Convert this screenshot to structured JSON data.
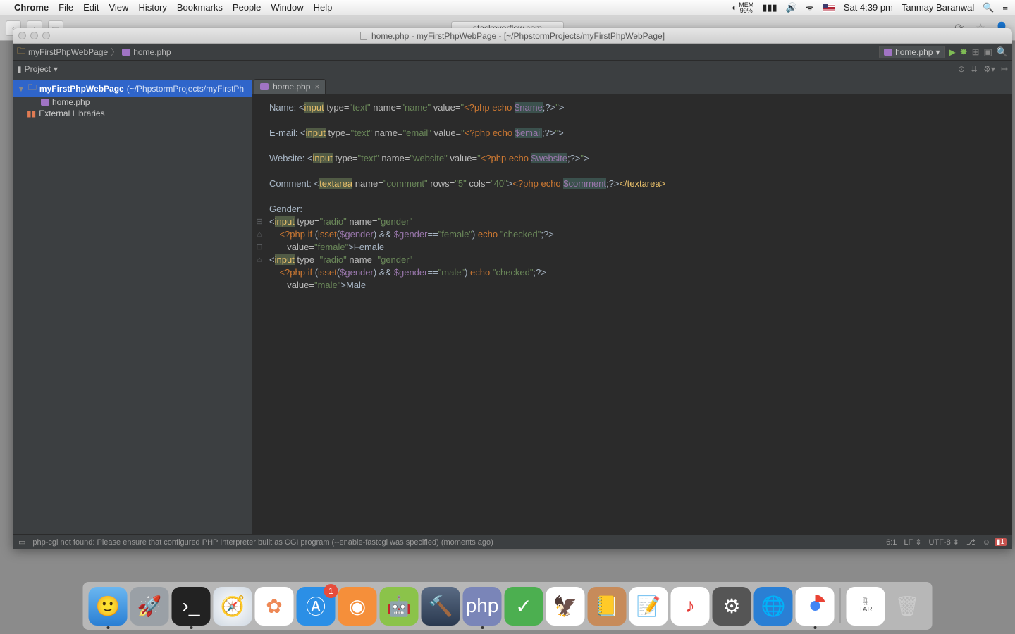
{
  "menubar": {
    "app": "Chrome",
    "items": [
      "File",
      "Edit",
      "View",
      "History",
      "Bookmarks",
      "People",
      "Window",
      "Help"
    ],
    "mem_label": "MEM",
    "mem_value": "99%",
    "date": "Sat 4:39 pm",
    "user": "Tanmay Baranwal"
  },
  "chrome": {
    "tab_title": "stackoverflow.com"
  },
  "ide": {
    "window_title": "home.php - myFirstPhpWebPage - [~/PhpstormProjects/myFirstPhpWebPage]",
    "breadcrumbs": {
      "project": "myFirstPhpWebPage",
      "file": "home.php"
    },
    "run_config": "home.php",
    "project_tool": "Project",
    "tree": {
      "root": "myFirstPhpWebPage",
      "root_path": "(~/PhpstormProjects/myFirstPh",
      "file": "home.php",
      "ext": "External Libraries"
    },
    "tab": "home.php",
    "notification": {
      "title": "php-cgi not found",
      "pre": "Please ensure that ",
      "link": "configured PHP Interpreter",
      "post": " built as CGI program (--enable-fastcgi was specified)"
    },
    "status": {
      "msg": "php-cgi not found: Please ensure that configured PHP Interpreter built as CGI program (--enable-fastcgi was specified) (moments ago)",
      "pos": "6:1",
      "lf": "LF",
      "enc": "UTF-8",
      "err_count": "1"
    },
    "code": {
      "l1_pre": "Name: <",
      "l1_tag": "input",
      "l1_attr": " type=",
      "l1_s1": "\"text\"",
      "l1_attr2": " name=",
      "l1_s2": "\"name\"",
      "l1_attr3": " value=",
      "l1_s3a": "\"",
      "l1_php": "<?php ",
      "l1_echo": "echo ",
      "l1_var": "$name",
      "l1_end": ";?>",
      "l1_s3b": "\"",
      "l1_close": ">",
      "l2_pre": "E-mail: <",
      "l2_tag": "input",
      "l2_s1": "\"text\"",
      "l2_s2": "\"email\"",
      "l2_var": "$email",
      "l3_pre": "Website: <",
      "l3_s2": "\"website\"",
      "l3_var": "$website",
      "l4_pre": "Comment: <",
      "l4_tag": "textarea",
      "l4_s1": "\"comment\"",
      "l4_rows": " rows=",
      "l4_rv": "\"5\"",
      "l4_cols": " cols=",
      "l4_cv": "\"40\"",
      "l4_var": "$comment",
      "l4_ct": "</textarea>",
      "l5": "Gender:",
      "l6_pre": "<",
      "l6_tag": "input",
      "l6_type": "\"radio\"",
      "l6_name": "\"gender\"",
      "l7_if": "if ",
      "l7_isset": "isset",
      "l7_var": "$gender",
      "l7_and": " && ",
      "l7_eq": "==",
      "l7_fem": "\"female\"",
      "l7_chk": "\"checked\"",
      "l8_val": "\"female\"",
      "l8_txt": ">Female",
      "l9_male": "\"male\"",
      "l10_val": "\"male\"",
      "l10_txt": ">Male"
    }
  },
  "dock": {
    "appstore_badge": "1",
    "tar_label": "TAR"
  }
}
